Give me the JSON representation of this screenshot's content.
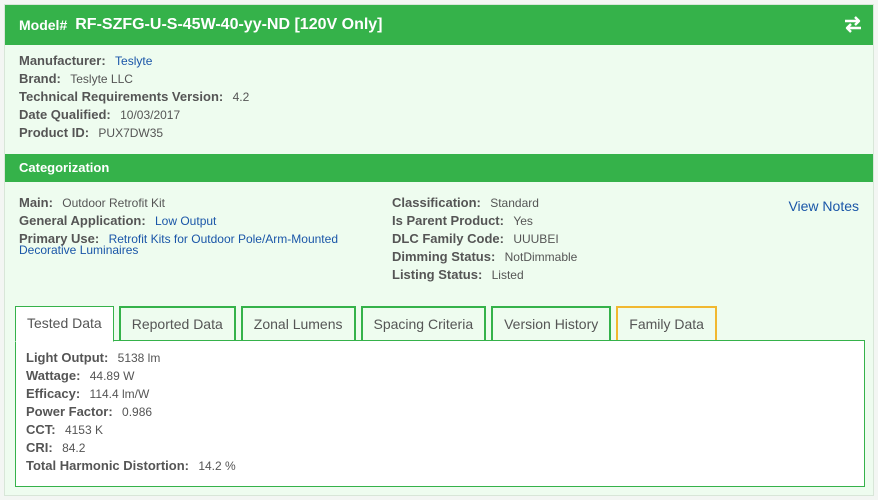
{
  "header": {
    "model_label": "Model#",
    "model_value": "RF-SZFG-U-S-45W-40-yy-ND [120V Only]",
    "swap_icon": "swap-arrows-icon"
  },
  "details": [
    {
      "label": "Manufacturer:",
      "value": "Teslyte",
      "link": true
    },
    {
      "label": "Brand:",
      "value": "Teslyte LLC",
      "link": false
    },
    {
      "label": "Technical Requirements Version:",
      "value": "4.2",
      "link": false
    },
    {
      "label": "Date Qualified:",
      "value": "10/03/2017",
      "link": false
    },
    {
      "label": "Product ID:",
      "value": "PUX7DW35",
      "link": false
    }
  ],
  "categorization": {
    "title": "Categorization",
    "left": [
      {
        "label": "Main:",
        "value": "Outdoor Retrofit Kit",
        "link": false
      },
      {
        "label": "General Application:",
        "value": "Low Output",
        "link": true
      },
      {
        "label": "Primary Use:",
        "value": "Retrofit Kits for Outdoor Pole/Arm-Mounted",
        "value2": "Decorative Luminaires",
        "link": true
      }
    ],
    "right": [
      {
        "label": "Classification:",
        "value": "Standard"
      },
      {
        "label": "Is Parent Product:",
        "value": "Yes"
      },
      {
        "label": "DLC Family Code:",
        "value": "UUUBEI"
      },
      {
        "label": "Dimming Status:",
        "value": "NotDimmable"
      },
      {
        "label": "Listing Status:",
        "value": "Listed"
      }
    ],
    "view_notes": "View Notes"
  },
  "tabs": [
    {
      "label": "Tested Data",
      "active": true
    },
    {
      "label": "Reported Data",
      "active": false
    },
    {
      "label": "Zonal Lumens",
      "active": false
    },
    {
      "label": "Spacing Criteria",
      "active": false
    },
    {
      "label": "Version History",
      "active": false
    },
    {
      "label": "Family Data",
      "active": false
    }
  ],
  "tested_data": [
    {
      "label": "Light Output:",
      "value": "5138 lm"
    },
    {
      "label": "Wattage:",
      "value": "44.89 W"
    },
    {
      "label": "Efficacy:",
      "value": "114.4 lm/W"
    },
    {
      "label": "Power Factor:",
      "value": "0.986"
    },
    {
      "label": "CCT:",
      "value": "4153 K"
    },
    {
      "label": "CRI:",
      "value": "84.2"
    },
    {
      "label": "Total Harmonic Distortion:",
      "value": "14.2 %"
    }
  ],
  "colors": {
    "accent": "#35b24a",
    "link": "#1a56a8",
    "family_tab": "#f1b830",
    "panel_bg": "#eefcef"
  }
}
